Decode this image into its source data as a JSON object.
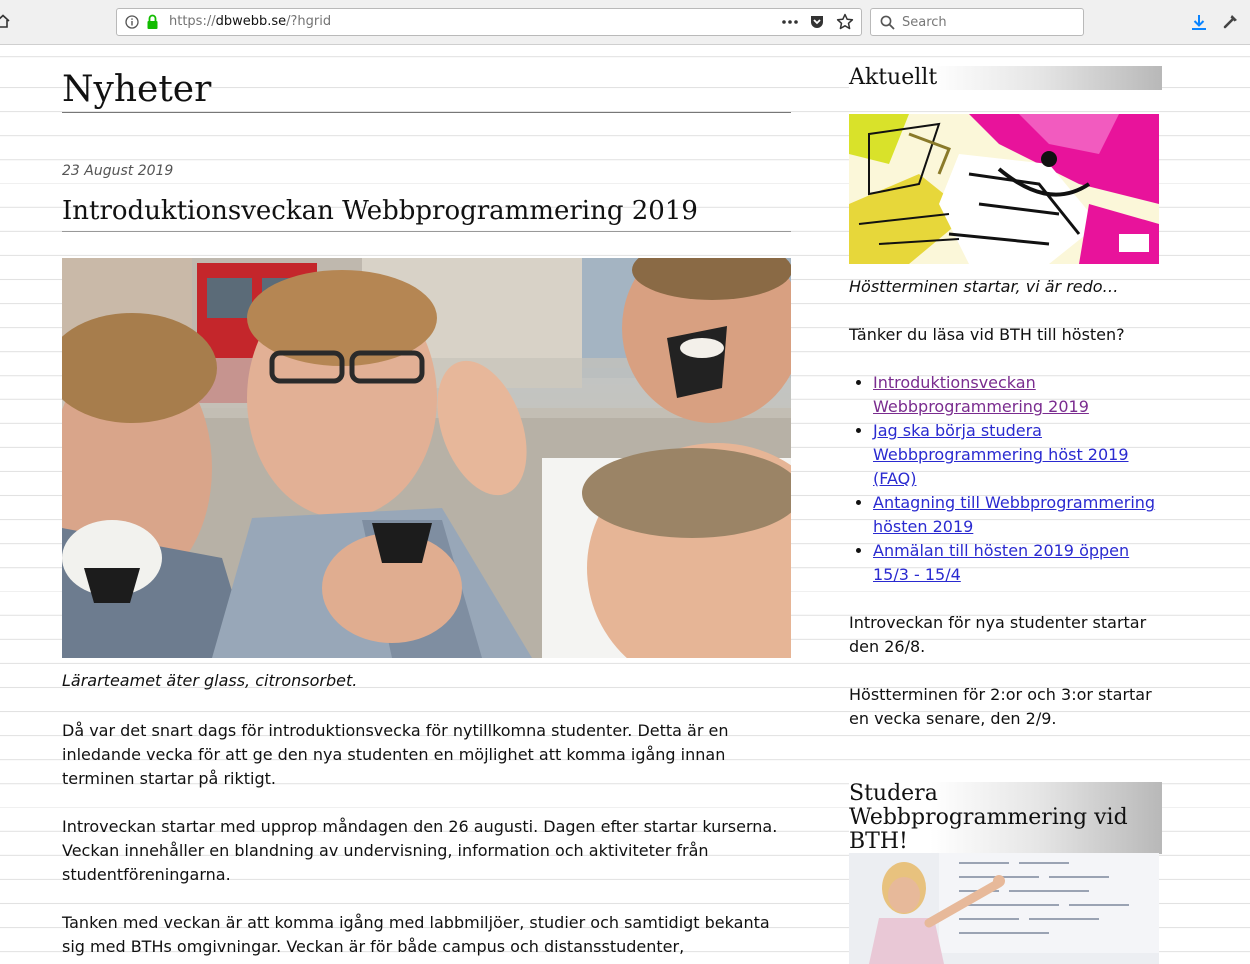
{
  "browser": {
    "url_prefix": "https://",
    "url_host": "dbwebb.se",
    "url_path": "/?hgrid",
    "search_placeholder": "Search"
  },
  "main": {
    "page_title": "Nyheter",
    "post": {
      "date": "23 August 2019",
      "title": "Introduktionsveckan Webbprogrammering 2019",
      "caption": "Lärarteamet äter glass, citronsorbet.",
      "paragraphs": [
        "Då var det snart dags för introduktionsvecka för nytillkomna studenter. Detta är en inledande vecka för att ge den nya studenten en möjlighet att komma igång innan terminen startar på riktigt.",
        "Introveckan startar med upprop måndagen den 26 augusti. Dagen efter startar kurserna. Veckan innehåller en blandning av undervisning, information och aktiviteter från studentföreningarna.",
        "Tanken med veckan är att komma igång med labbmiljöer, studier och samtidigt bekanta sig med BTHs omgivningar. Veckan är för både campus och distansstudenter,"
      ]
    }
  },
  "sidebar": {
    "aktuellt_heading": "Aktuellt",
    "image_caption": "Höstterminen startar, vi är redo…",
    "question": "Tänker du läsa vid BTH till hösten?",
    "links": [
      {
        "label": "Introduktionsveckan Webbprogrammering 2019",
        "visited": true
      },
      {
        "label": "Jag ska börja studera Webbprogrammering höst 2019 (FAQ)",
        "visited": false
      },
      {
        "label": "Antagning till Webbprogrammering hösten 2019",
        "visited": false
      },
      {
        "label": "Anmälan till hösten 2019 öppen 15/3 - 15/4",
        "visited": false
      }
    ],
    "intro_text": "Introveckan för nya studenter startar den 26/8.",
    "term_text": "Höstterminen för 2:or och 3:or startar en vecka senare, den 2/9.",
    "study_heading": "Studera Webbprogrammering vid BTH!"
  }
}
